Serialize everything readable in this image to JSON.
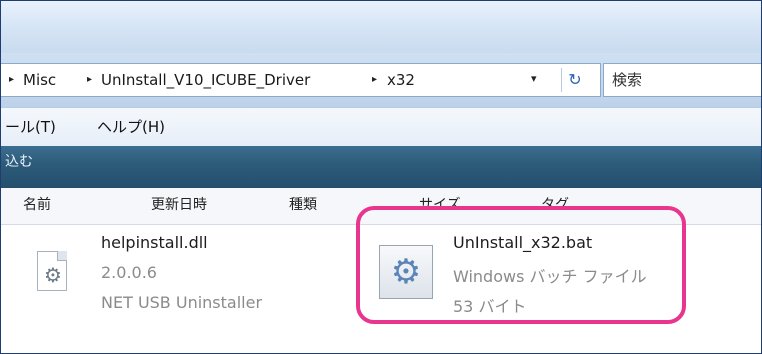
{
  "address": {
    "crumbs": [
      "Misc",
      "UnInstall_V10_ICUBE_Driver",
      "x32"
    ],
    "separator": "▸",
    "dropdown": "▾",
    "refresh": "↻"
  },
  "search": {
    "placeholder": "検索"
  },
  "menu": {
    "tools": "ール(T)",
    "help": "ヘルプ(H)"
  },
  "toolbar": {
    "label": "込む"
  },
  "columns": [
    "名前",
    "更新日時",
    "種類",
    "サイズ",
    "タグ"
  ],
  "files": [
    {
      "name": "helpinstall.dll",
      "line2": "2.0.0.6",
      "line3": "NET USB Uninstaller",
      "icon": "dll-gear-icon"
    },
    {
      "name": "UnInstall_x32.bat",
      "line2": "Windows バッチ ファイル",
      "line3": "53 バイト",
      "icon": "batch-gear-icon"
    }
  ],
  "colors": {
    "highlight": "#e8368f",
    "toolbar": "#2c5a79",
    "frame": "#1f3d73"
  }
}
